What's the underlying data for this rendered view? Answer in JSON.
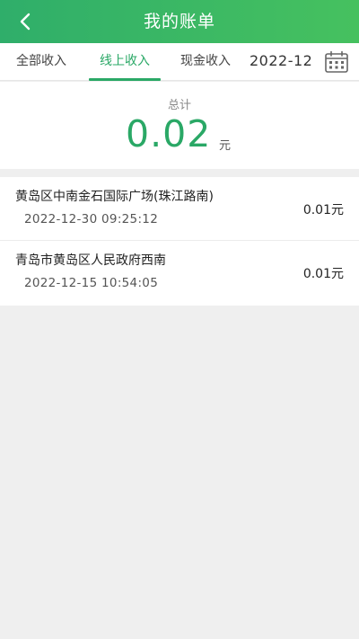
{
  "header": {
    "title": "我的账单",
    "back_icon": "chevron-left-icon"
  },
  "tabs": [
    {
      "label": "全部收入",
      "active": false
    },
    {
      "label": "线上收入",
      "active": true
    },
    {
      "label": "现金收入",
      "active": false
    }
  ],
  "date_filter": {
    "label": "2022-12",
    "icon": "calendar-icon"
  },
  "summary": {
    "label": "总计",
    "amount": "0.02",
    "unit": "元"
  },
  "transactions": [
    {
      "location": "黄岛区中南金石国际广场(珠江路南)",
      "time": "2022-12-30 09:25:12",
      "amount": "0.01元"
    },
    {
      "location": "青岛市黄岛区人民政府西南",
      "time": "2022-12-15 10:54:05",
      "amount": "0.01元"
    }
  ],
  "colors": {
    "brand": "#2aa866",
    "header_start": "#2fae6a",
    "header_end": "#46c15f",
    "background": "#efefef"
  }
}
